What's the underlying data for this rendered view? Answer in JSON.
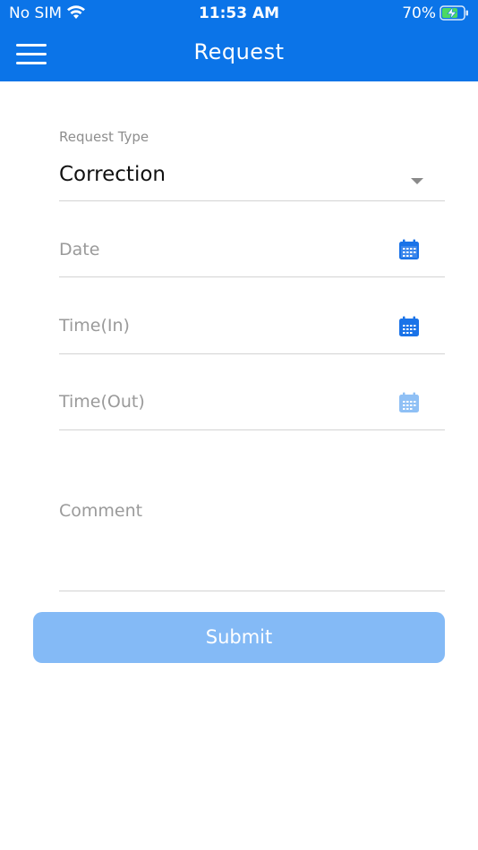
{
  "status_bar": {
    "carrier": "No SIM",
    "time": "11:53 AM",
    "battery": "70%"
  },
  "header": {
    "title": "Request",
    "menu_icon": "hamburger-menu-icon"
  },
  "form": {
    "request_type": {
      "label": "Request Type",
      "value": "Correction"
    },
    "date": {
      "placeholder": "Date",
      "icon": "calendar-icon"
    },
    "time_in": {
      "placeholder": "Time(In)",
      "icon": "calendar-icon"
    },
    "time_out": {
      "placeholder": "Time(Out)",
      "icon": "calendar-icon"
    },
    "comment": {
      "placeholder": "Comment"
    },
    "submit_label": "Submit"
  },
  "colors": {
    "primary": "#0b74e8",
    "submit_disabled": "#84baf6",
    "calendar_active": "#1a73e8",
    "calendar_disabled": "#8fc0f5"
  }
}
